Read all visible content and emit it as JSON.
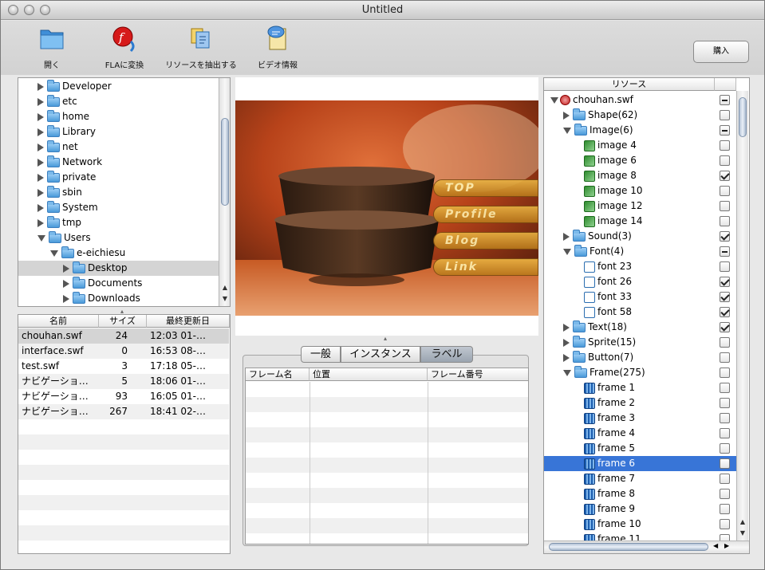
{
  "window": {
    "title": "Untitled"
  },
  "toolbar": {
    "open_label": "開く",
    "fla_label": "FLAに変換",
    "extract_label": "リソースを抽出する",
    "video_label": "ビデオ情報",
    "buy_label": "購入"
  },
  "dir_tree": {
    "items": [
      {
        "label": "Developer",
        "expanded": false,
        "level": 0
      },
      {
        "label": "etc",
        "expanded": false,
        "level": 0
      },
      {
        "label": "home",
        "expanded": false,
        "level": 0
      },
      {
        "label": "Library",
        "expanded": false,
        "level": 0
      },
      {
        "label": "net",
        "expanded": false,
        "level": 0
      },
      {
        "label": "Network",
        "expanded": false,
        "level": 0
      },
      {
        "label": "private",
        "expanded": false,
        "level": 0
      },
      {
        "label": "sbin",
        "expanded": false,
        "level": 0
      },
      {
        "label": "System",
        "expanded": false,
        "level": 0
      },
      {
        "label": "tmp",
        "expanded": false,
        "level": 0
      },
      {
        "label": "Users",
        "expanded": true,
        "level": 0
      },
      {
        "label": "e-eichiesu",
        "expanded": true,
        "level": 1
      },
      {
        "label": "Desktop",
        "expanded": false,
        "level": 2,
        "selected": true
      },
      {
        "label": "Documents",
        "expanded": false,
        "level": 2
      },
      {
        "label": "Downloads",
        "expanded": false,
        "level": 2
      }
    ]
  },
  "file_list": {
    "headers": {
      "name": "名前",
      "size": "サイズ",
      "modified": "最終更新日"
    },
    "rows": [
      {
        "name": "chouhan.swf",
        "size": "24",
        "modified": "12:03 01-…",
        "selected": true
      },
      {
        "name": "interface.swf",
        "size": "0",
        "modified": "16:53 08-…"
      },
      {
        "name": "test.swf",
        "size": "3",
        "modified": "17:18 05-…"
      },
      {
        "name": "ナビゲーショ…",
        "size": "5",
        "modified": "18:06 01-…"
      },
      {
        "name": "ナビゲーショ…",
        "size": "93",
        "modified": "16:05 01-…"
      },
      {
        "name": "ナビゲーショ…",
        "size": "267",
        "modified": "18:41 02-…"
      }
    ]
  },
  "preview": {
    "buttons": [
      "TOP",
      "Profile",
      "Blog",
      "Link"
    ],
    "colors": {
      "bg_dark": "#5a2410",
      "bg_orange": "#d9541e",
      "bowl": "#3a2418",
      "tab": "#e2a23a"
    }
  },
  "tabs": {
    "items": [
      "一般",
      "インスタンス",
      "ラベル"
    ],
    "selected_index": 2
  },
  "label_table": {
    "headers": [
      "フレーム名",
      "位置",
      "フレーム番号"
    ]
  },
  "resources": {
    "header": "リソース",
    "items": [
      {
        "label": "chouhan.swf",
        "icon": "swf-icon",
        "level": 0,
        "expanded": true,
        "check": "mixed"
      },
      {
        "label": "Shape(62)",
        "icon": "folder-icon",
        "level": 1,
        "expanded": false,
        "check": "off"
      },
      {
        "label": "Image(6)",
        "icon": "folder-icon",
        "level": 1,
        "expanded": true,
        "check": "mixed"
      },
      {
        "label": "image 4",
        "icon": "image-icon",
        "level": 2,
        "check": "off"
      },
      {
        "label": "image 6",
        "icon": "image-icon",
        "level": 2,
        "check": "off"
      },
      {
        "label": "image 8",
        "icon": "image-icon",
        "level": 2,
        "check": "on"
      },
      {
        "label": "image 10",
        "icon": "image-icon",
        "level": 2,
        "check": "off"
      },
      {
        "label": "image 12",
        "icon": "image-icon",
        "level": 2,
        "check": "off"
      },
      {
        "label": "image 14",
        "icon": "image-icon",
        "level": 2,
        "check": "off"
      },
      {
        "label": "Sound(3)",
        "icon": "folder-icon",
        "level": 1,
        "expanded": false,
        "check": "on"
      },
      {
        "label": "Font(4)",
        "icon": "folder-icon",
        "level": 1,
        "expanded": true,
        "check": "mixed"
      },
      {
        "label": "font 23",
        "icon": "font-icon",
        "level": 2,
        "check": "off"
      },
      {
        "label": "font 26",
        "icon": "font-icon",
        "level": 2,
        "check": "on"
      },
      {
        "label": "font 33",
        "icon": "font-icon",
        "level": 2,
        "check": "on"
      },
      {
        "label": "font 58",
        "icon": "font-icon",
        "level": 2,
        "check": "on"
      },
      {
        "label": "Text(18)",
        "icon": "folder-icon",
        "level": 1,
        "expanded": false,
        "check": "on"
      },
      {
        "label": "Sprite(15)",
        "icon": "folder-icon",
        "level": 1,
        "expanded": false,
        "check": "off"
      },
      {
        "label": "Button(7)",
        "icon": "folder-icon",
        "level": 1,
        "expanded": false,
        "check": "off"
      },
      {
        "label": "Frame(275)",
        "icon": "folder-icon",
        "level": 1,
        "expanded": true,
        "check": "off"
      },
      {
        "label": "frame 1",
        "icon": "frame-icon",
        "level": 2,
        "check": "off"
      },
      {
        "label": "frame 2",
        "icon": "frame-icon",
        "level": 2,
        "check": "off"
      },
      {
        "label": "frame 3",
        "icon": "frame-icon",
        "level": 2,
        "check": "off"
      },
      {
        "label": "frame 4",
        "icon": "frame-icon",
        "level": 2,
        "check": "off"
      },
      {
        "label": "frame 5",
        "icon": "frame-icon",
        "level": 2,
        "check": "off"
      },
      {
        "label": "frame 6",
        "icon": "frame-icon",
        "level": 2,
        "check": "off",
        "selected": true
      },
      {
        "label": "frame 7",
        "icon": "frame-icon",
        "level": 2,
        "check": "off"
      },
      {
        "label": "frame 8",
        "icon": "frame-icon",
        "level": 2,
        "check": "off"
      },
      {
        "label": "frame 9",
        "icon": "frame-icon",
        "level": 2,
        "check": "off"
      },
      {
        "label": "frame 10",
        "icon": "frame-icon",
        "level": 2,
        "check": "off"
      },
      {
        "label": "frame 11",
        "icon": "frame-icon",
        "level": 2,
        "check": "off"
      }
    ]
  },
  "colors": {
    "selection": "#3875d7",
    "row_alt": "#f0f0f0",
    "list_selected": "#d4d4d4"
  }
}
